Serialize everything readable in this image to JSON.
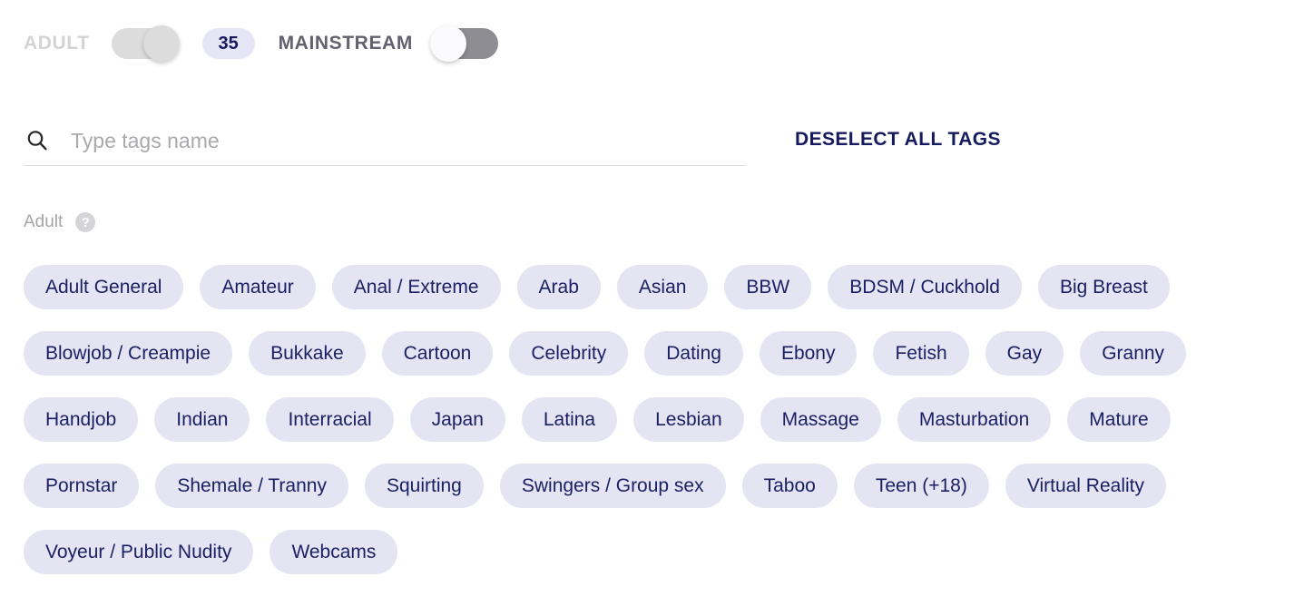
{
  "toggle_bar": {
    "adult_label": "ADULT",
    "mainstream_label": "MAINSTREAM",
    "count": "35",
    "adult_toggle_state": "on-right",
    "mainstream_toggle_state": "off-left"
  },
  "search": {
    "placeholder": "Type tags name",
    "value": "",
    "icon": "search-icon"
  },
  "actions": {
    "deselect_all": "DESELECT ALL TAGS"
  },
  "group": {
    "title": "Adult",
    "help_icon": "?"
  },
  "colors": {
    "tag_bg": "#e4e4f3",
    "tag_text": "#1a1f63",
    "accent_navy": "#161a5e",
    "badge_bg": "#e5e5f5",
    "toggle_off_track": "#dcdcdd",
    "toggle_on_track": "#8d8d93"
  },
  "tag_rows": [
    [
      "Adult General",
      "Amateur",
      "Anal / Extreme",
      "Arab",
      "Asian",
      "BBW",
      "BDSM / Cuckhold",
      "Big Breast"
    ],
    [
      "Blowjob / Creampie",
      "Bukkake",
      "Cartoon",
      "Celebrity",
      "Dating",
      "Ebony",
      "Fetish",
      "Gay",
      "Granny"
    ],
    [
      "Handjob",
      "Indian",
      "Interracial",
      "Japan",
      "Latina",
      "Lesbian",
      "Massage",
      "Masturbation",
      "Mature"
    ],
    [
      "Pornstar",
      "Shemale / Tranny",
      "Squirting",
      "Swingers / Group sex",
      "Taboo",
      "Teen (+18)",
      "Virtual Reality"
    ],
    [
      "Voyeur / Public Nudity",
      "Webcams"
    ]
  ]
}
